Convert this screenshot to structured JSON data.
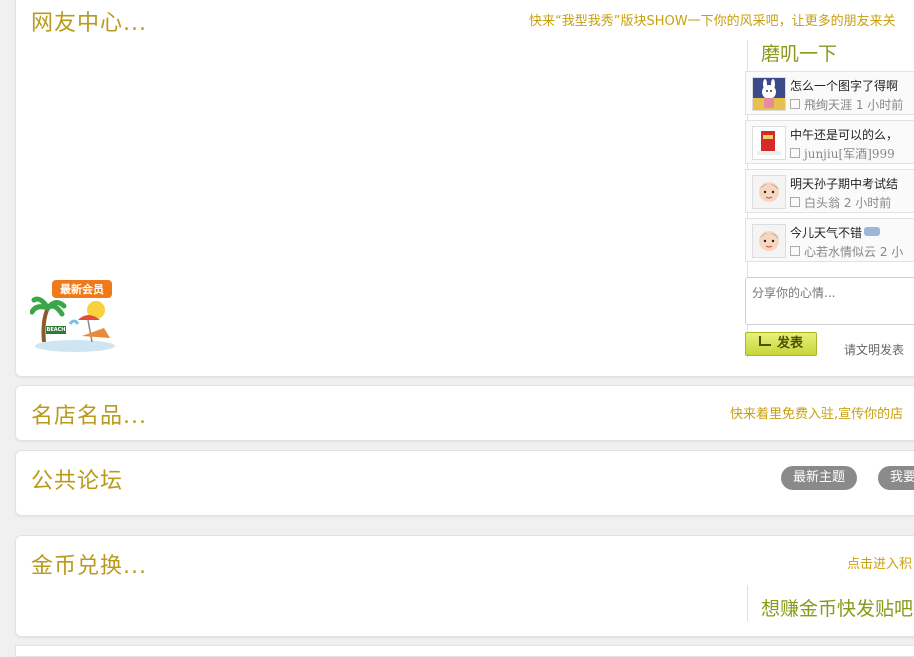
{
  "friend_center": {
    "title": "网友中心...",
    "promo": "快来“我型我秀”版块SHOW一下你的风采吧，让更多的朋友来关",
    "new_member_badge": "最新会员",
    "beach_label": "BEACH",
    "sidebar_title": "磨叽一下",
    "feed": [
      {
        "text": "怎么一个图字了得啊",
        "user": "飛绚天涯",
        "time": "1 小时前"
      },
      {
        "text": "中午还是可以的么，",
        "user": "junjiu[军酒]999",
        "time": ""
      },
      {
        "text": "明天孙子期中考试结",
        "user": "白头翁",
        "time": "2 小时前"
      },
      {
        "text": "今儿天气不错",
        "user": "心若水情似云",
        "time": "2 小"
      }
    ],
    "mood_placeholder": "分享你的心情...",
    "post_button": "发表",
    "post_tip": "请文明发表"
  },
  "famous_shops": {
    "title": "名店名品...",
    "promo": "快来着里免费入驻,宣传你的店"
  },
  "public_forum": {
    "title": "公共论坛",
    "buttons": [
      "最新主题",
      "我要"
    ]
  },
  "gold_exchange": {
    "title": "金币兑换...",
    "promo": "点击进入积",
    "sidebar_title": "想赚金币快发贴吧"
  }
}
